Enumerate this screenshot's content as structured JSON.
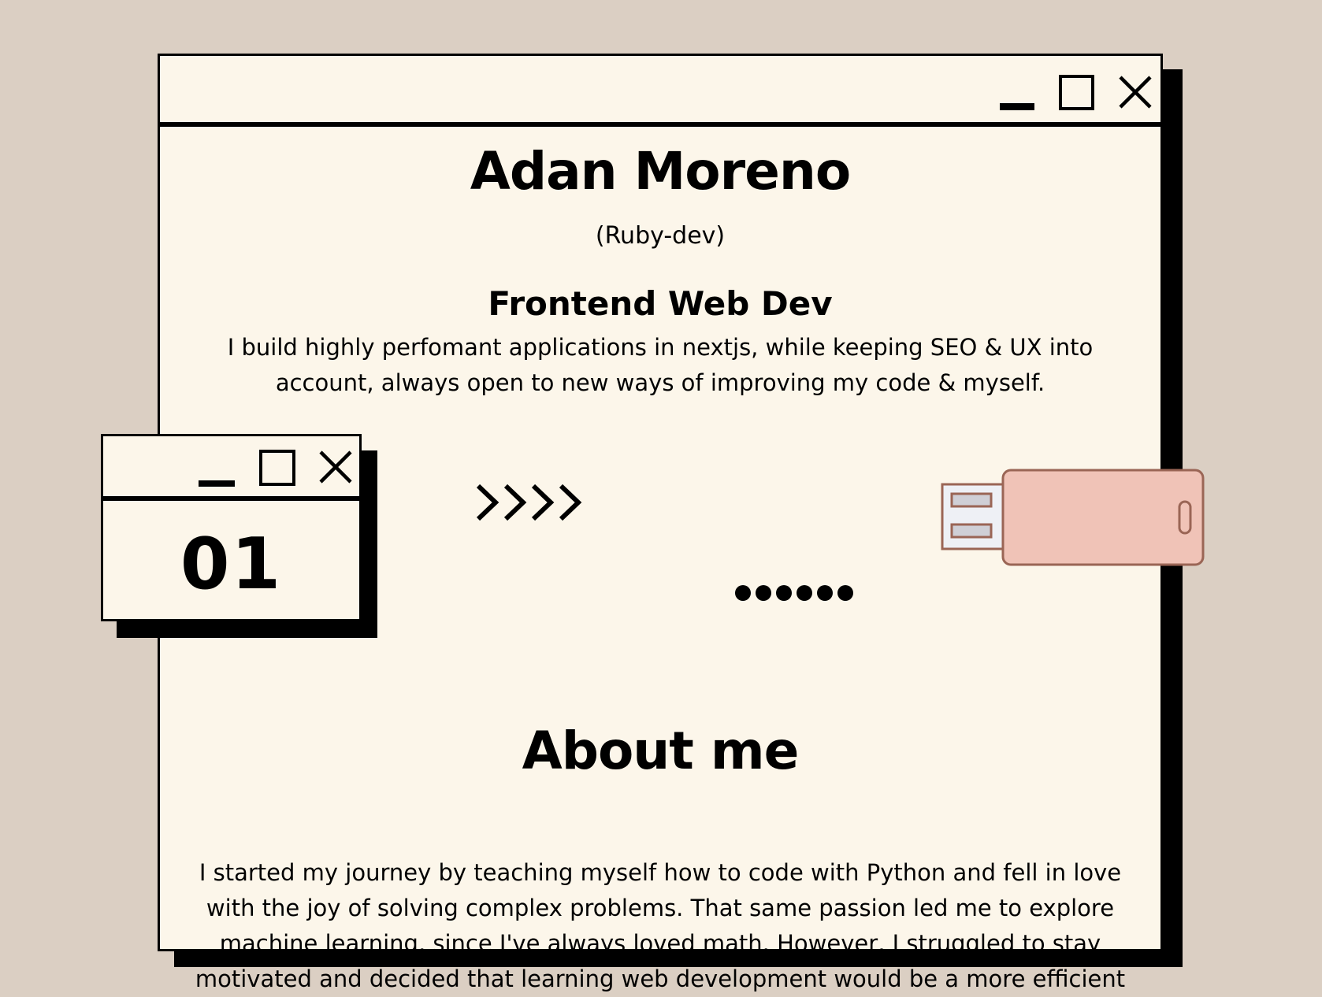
{
  "hero": {
    "name": "Adan Moreno",
    "alias": "(Ruby-dev)",
    "role": "Frontend Web Dev",
    "description": "I build highly perfomant applications in nextjs, while keeping SEO & UX into account, always open to new ways of improving my code & myself."
  },
  "badge": {
    "number": "01"
  },
  "about": {
    "title": "About me",
    "text": "I started my journey by teaching myself how to code with Python and fell in love with the joy of solving complex problems. That same passion led me to explore machine learning, since I've always loved math. However, I struggled to stay motivated and decided that learning web development would be a more efficient"
  },
  "icons": {
    "minimize": "minimize-icon",
    "maximize": "maximize-icon",
    "close": "close-icon",
    "usb": "usb-drive-icon",
    "arrows": "chevrons-right-icon",
    "dots": "dots-icon"
  },
  "colors": {
    "page_bg": "#dbcfc3",
    "window_bg": "#fcf6ea",
    "ink": "#000000",
    "usb_body": "#f0c3b7",
    "usb_outline": "#9a6555",
    "usb_plug": "#eef0f5",
    "usb_slot": "#cfcfd6"
  }
}
